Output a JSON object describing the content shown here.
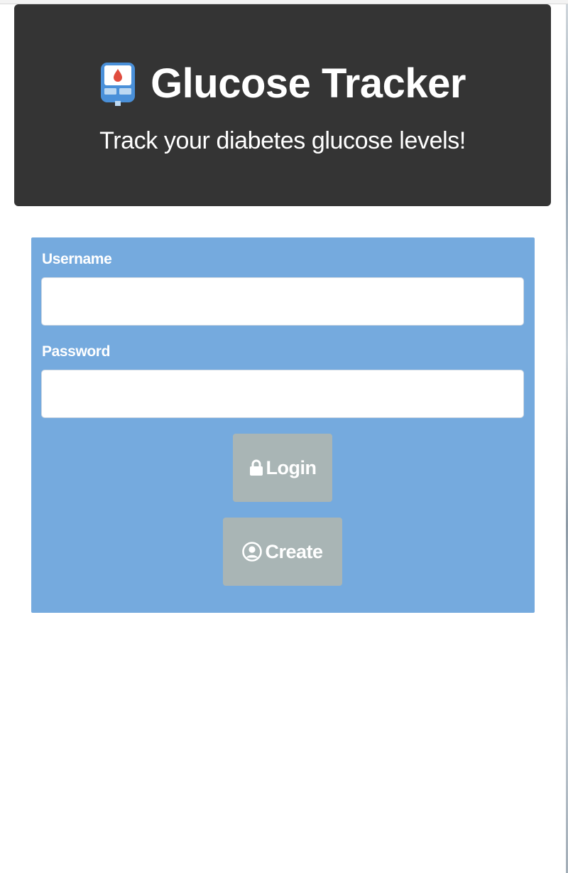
{
  "header": {
    "icon": "glucose-meter-icon",
    "title": "Glucose Tracker",
    "subtitle": "Track your diabetes glucose levels!"
  },
  "form": {
    "username_label": "Username",
    "username_value": "",
    "password_label": "Password",
    "password_value": "",
    "login_button": {
      "label": "Login",
      "icon": "lock-icon"
    },
    "create_button": {
      "label": "Create",
      "icon": "user-circle-icon"
    }
  },
  "colors": {
    "header_bg": "#343434",
    "panel_bg": "#75aade",
    "button_bg": "#a9b5b5",
    "text_light": "#ffffff"
  }
}
